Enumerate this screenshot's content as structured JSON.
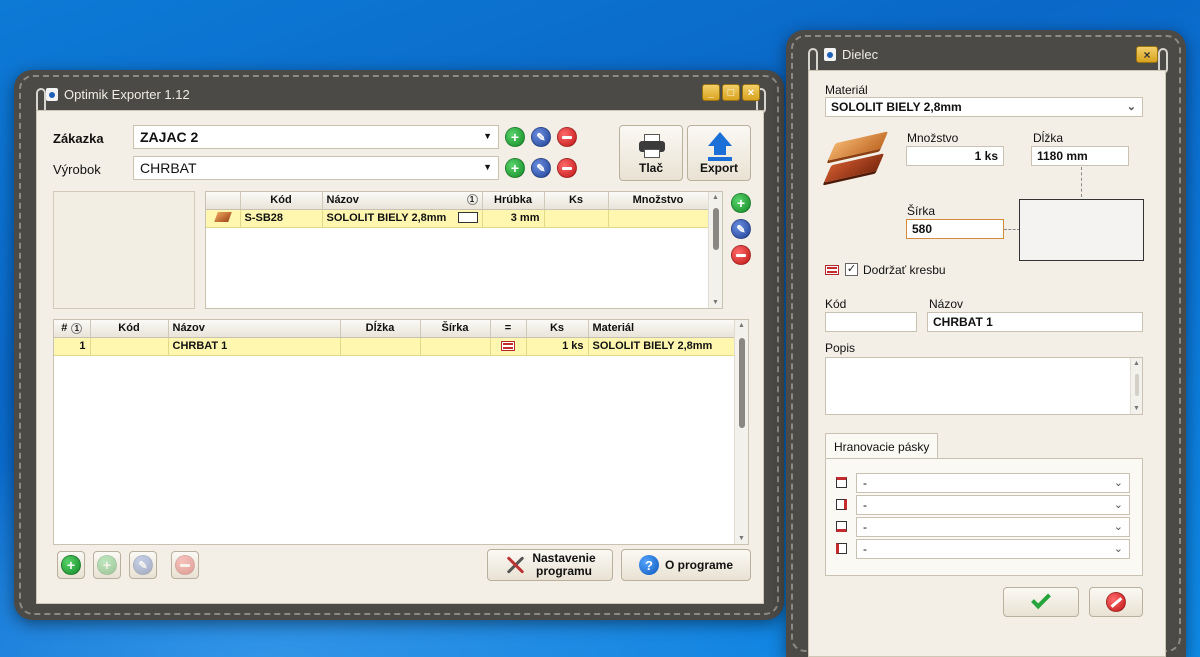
{
  "main_window": {
    "title": "Optimik Exporter 1.12",
    "zakazka_label": "Zákazka",
    "zakazka_value": "ZAJAC 2",
    "vyrobok_label": "Výrobok",
    "vyrobok_value": "CHRBAT",
    "print_label": "Tlač",
    "export_label": "Export",
    "materials": {
      "columns": [
        "Kód",
        "Názov",
        "Hrúbka",
        "Ks",
        "Množstvo"
      ],
      "rows": [
        {
          "kod": "S-SB28",
          "nazov": "SOLOLIT BIELY 2,8mm",
          "hrubka": "3 mm",
          "ks": "",
          "mnozstvo": ""
        }
      ]
    },
    "parts": {
      "columns": [
        "#",
        "Kód",
        "Názov",
        "Dĺžka",
        "Šírka",
        "=",
        "Ks",
        "Materiál"
      ],
      "rows": [
        {
          "num": "1",
          "kod": "",
          "nazov": "CHRBAT 1",
          "dlzka": "",
          "sirka": "",
          "ks": "1 ks",
          "material": "SOLOLIT BIELY 2,8mm"
        }
      ]
    },
    "sort_mark": "1",
    "settings_label_1": "Nastavenie",
    "settings_label_2": "programu",
    "about_label": "O programe"
  },
  "dialog": {
    "title": "Dielec",
    "material_label": "Materiál",
    "material_value": "SOLOLIT BIELY 2,8mm",
    "mnozstvo_label": "Množstvo",
    "mnozstvo_value": "1 ks",
    "dlzka_label": "Dĺžka",
    "dlzka_value": "1180 mm",
    "sirka_label": "Šírka",
    "sirka_value": "580",
    "grain_label": "Dodržať kresbu",
    "kod_label": "Kód",
    "kod_value": "",
    "nazov_label": "Názov",
    "nazov_value": "CHRBAT 1",
    "popis_label": "Popis",
    "edge_tab_label": "Hranovacie pásky",
    "edges": [
      "-",
      "-",
      "-",
      "-"
    ]
  },
  "colors": {
    "selected_row": "#fff7b0",
    "window_frame": "#4c4a47",
    "panel_bg": "#f3efe6",
    "desktop": "#0a68c8"
  },
  "icons": [
    "app-icon",
    "printer-icon",
    "export-arrow-icon",
    "add-icon",
    "edit-icon",
    "delete-icon",
    "help-icon",
    "tools-icon",
    "close-icon",
    "checkmark-icon",
    "cancel-icon",
    "board-icon"
  ]
}
